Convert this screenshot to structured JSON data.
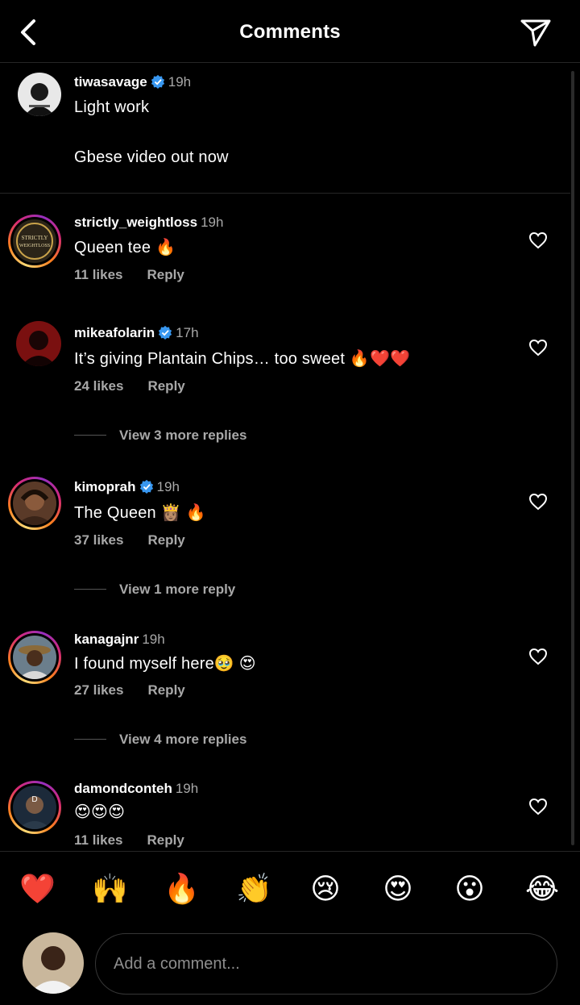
{
  "header": {
    "title": "Comments",
    "back_icon": "chevron-left-icon",
    "send_icon": "paper-plane-icon"
  },
  "caption": {
    "username": "tiwasavage",
    "verified": true,
    "time": "19h",
    "line1": "Light work",
    "line2": "Gbese video out now"
  },
  "comments": [
    {
      "username": "strictly_weightloss",
      "verified": false,
      "time": "19h",
      "text": "Queen tee 🔥",
      "likes": "11 likes",
      "reply": "Reply"
    },
    {
      "username": "mikeafolarin",
      "verified": true,
      "time": "17h",
      "text": "It’s giving Plantain Chips… too sweet 🔥❤️❤️",
      "likes": "24 likes",
      "reply": "Reply",
      "view_more": "View 3 more replies"
    },
    {
      "username": "kimoprah",
      "verified": true,
      "time": "19h",
      "text": "The Queen 👸🏽 🔥",
      "likes": "37 likes",
      "reply": "Reply",
      "view_more": "View 1 more reply"
    },
    {
      "username": "kanagajnr",
      "verified": false,
      "time": "19h",
      "text": "I found myself here🥹 😍",
      "likes": "27 likes",
      "reply": "Reply",
      "view_more": "View 4 more replies"
    },
    {
      "username": "damondconteh",
      "verified": false,
      "time": "19h",
      "text": "😍😍😍",
      "likes": "11 likes",
      "reply": "Reply"
    }
  ],
  "quick_emojis": [
    "❤️",
    "🙌",
    "🔥",
    "👏",
    "😢",
    "😍",
    "😮",
    "😂"
  ],
  "composer": {
    "placeholder": "Add a comment..."
  },
  "colors": {
    "background": "#000000",
    "secondary_text": "#a8a8a8",
    "verified": "#3897f0",
    "divider": "#262626"
  }
}
